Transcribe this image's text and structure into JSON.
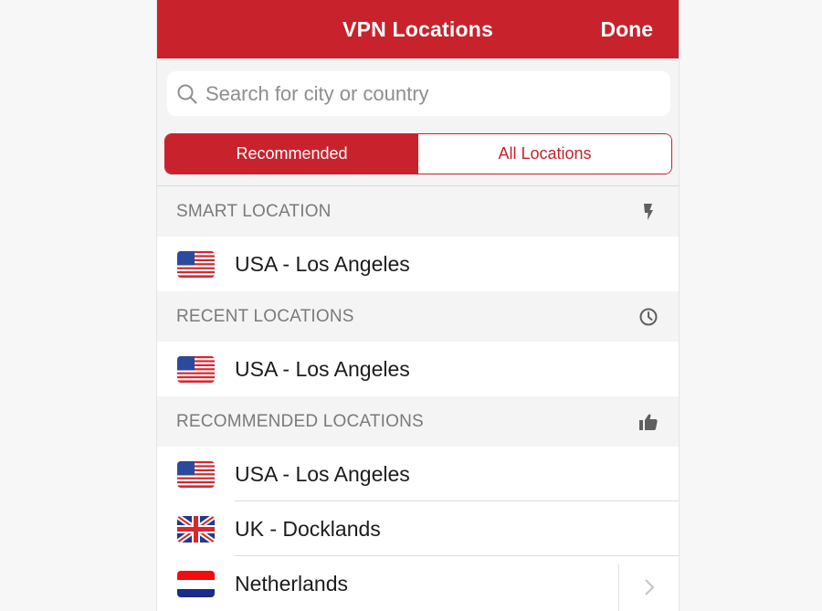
{
  "navbar": {
    "title": "VPN Locations",
    "done_label": "Done"
  },
  "search": {
    "placeholder": "Search for city or country",
    "value": "",
    "icon": "search-icon"
  },
  "tabs": [
    {
      "label": "Recommended",
      "active": true
    },
    {
      "label": "All Locations",
      "active": false
    }
  ],
  "sections": {
    "smart": {
      "title": "SMART LOCATION",
      "icon": "lightning-bolt-icon",
      "items": [
        {
          "name": "USA - Los Angeles",
          "flag": "usa-flag"
        }
      ]
    },
    "recent": {
      "title": "RECENT LOCATIONS",
      "icon": "clock-icon",
      "items": [
        {
          "name": "USA - Los Angeles",
          "flag": "usa-flag"
        }
      ]
    },
    "recommended": {
      "title": "RECOMMENDED LOCATIONS",
      "icon": "thumbs-up-icon",
      "items": [
        {
          "name": "USA - Los Angeles",
          "flag": "usa-flag"
        },
        {
          "name": "UK - Docklands",
          "flag": "uk-flag"
        },
        {
          "name": "Netherlands",
          "flag": "netherlands-flag",
          "expandable": true
        }
      ]
    }
  },
  "colors": {
    "accent": "#c8222c",
    "header_text": "#7a7a7a",
    "background": "#f4f4f4"
  }
}
